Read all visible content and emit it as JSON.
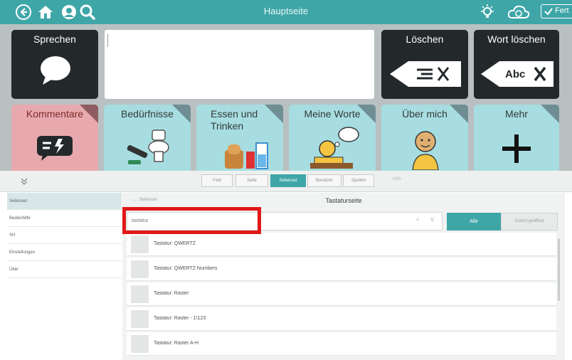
{
  "topbar": {
    "title": "Hauptseite",
    "done_label": "Fert"
  },
  "board": {
    "speak_label": "Sprechen",
    "delete_label": "Löschen",
    "delete_word_label": "Wort löschen",
    "delete_word_icon_text": "Abc",
    "tiles": [
      {
        "label": "Kommentare"
      },
      {
        "label": "Bedürfnisse"
      },
      {
        "label": "Essen und Trinken"
      },
      {
        "label": "Meine Worte"
      },
      {
        "label": "Über mich"
      },
      {
        "label": "Mehr"
      }
    ]
  },
  "subbar": {
    "segments": [
      {
        "label": "Feld"
      },
      {
        "label": "Seite"
      },
      {
        "label": "Seitenset"
      },
      {
        "label": "Benutzer"
      },
      {
        "label": "Spalten"
      }
    ],
    "extra": "Hilfe"
  },
  "sidebar": {
    "items": [
      {
        "label": "Seitenset"
      },
      {
        "label": "Bedienhilfe"
      },
      {
        "label": "SH"
      },
      {
        "label": "Einstellungen"
      },
      {
        "label": "Über"
      }
    ]
  },
  "panel": {
    "breadcrumb": "Seitenset",
    "title": "Tastaturseite",
    "search_value": "tastatur",
    "all_button": "Alle",
    "add_button": "Zuletzt geöffnet",
    "results": [
      {
        "label": "Tastatur: QWERTZ"
      },
      {
        "label": "Tastatur: QWERTZ Numbers"
      },
      {
        "label": "Tastatur: Raster"
      },
      {
        "label": "Tastatur: Raster - 1\\123"
      },
      {
        "label": "Tastatur: Raster A-H"
      }
    ]
  },
  "colors": {
    "accent": "#3fa6a8",
    "dark_tile": "#23282b",
    "comment_tile": "#e7a9ad",
    "category_tile": "#a7dde0",
    "highlight": "#e01818"
  }
}
